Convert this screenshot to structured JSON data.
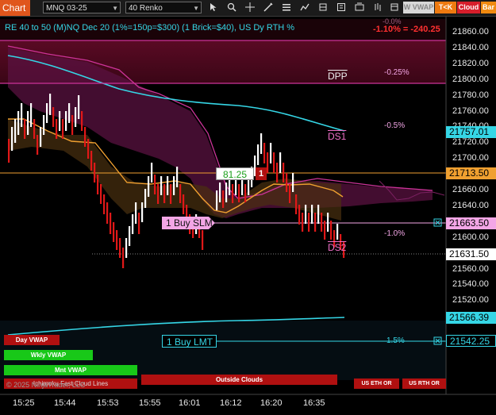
{
  "toolbar": {
    "chart_tab": "Chart",
    "symbol": "MNQ 03-25",
    "bar_type": "40 Renko",
    "buttons": {
      "wvwap": "W VWAP",
      "tk": "T<K",
      "cloud": "Cloud",
      "bar": "Bar"
    }
  },
  "chart": {
    "title": "RE 40 to 50 (M)NQ Dec 20 (1%=150p=$300) (1 Brick=$40), US Dy RTH %",
    "change_text": "-1.10% = -240.25",
    "y_ticks": [
      "21860.00",
      "21840.00",
      "21820.00",
      "21800.00",
      "21780.00",
      "21760.00",
      "21740.00",
      "21720.00",
      "21700.00",
      "21680.00",
      "21660.00",
      "21640.00",
      "21620.00",
      "21600.00",
      "21580.00",
      "21560.00",
      "21540.00",
      "21520.00",
      "21500.00"
    ],
    "x_ticks": [
      "15:25",
      "15:44",
      "15:53",
      "15:55",
      "16:01",
      "16:12",
      "16:20",
      "16:35"
    ],
    "price_tags": {
      "cyan_upper": "21757.01",
      "orange": "21713.50",
      "buy_slm": "21663.50",
      "last": "21631.50",
      "cyan_lower": "21566.39",
      "buy_lmt": "21542.25"
    },
    "levels": {
      "dpp": "DPP",
      "dpp_pct": "-0.25%",
      "ds1": "DS1",
      "ds1_pct": "-0.5%",
      "ds2": "DS2",
      "ds2_pct": "-1.0%",
      "lmt_pct": "1.5%",
      "top_pct": "-0.0%"
    },
    "orders": {
      "buy_slm": "1 Buy SLM",
      "buy_lmt": "1 Buy LMT"
    },
    "position": {
      "value": "81.25",
      "qty": "1"
    },
    "vwap_buttons": {
      "day": "Day VWAP",
      "wkly": "Wkly VWAP",
      "mnt": "Mnt VWAP"
    },
    "watermark": "© 2025 NinjaTrader, LLC",
    "fast_cloud": "Ichimoku Fast Cloud Lines",
    "outside_clouds": "Outside Clouds",
    "us_eth": "US ETH OR",
    "us_rth": "US RTH OR"
  },
  "colors": {
    "accent": "#e0561c",
    "cyan": "#35d6e6",
    "orange": "#f0a030",
    "magenta": "#cc3399",
    "pink": "#f3a6e6",
    "up": "#ffffff",
    "down": "#e01818"
  }
}
